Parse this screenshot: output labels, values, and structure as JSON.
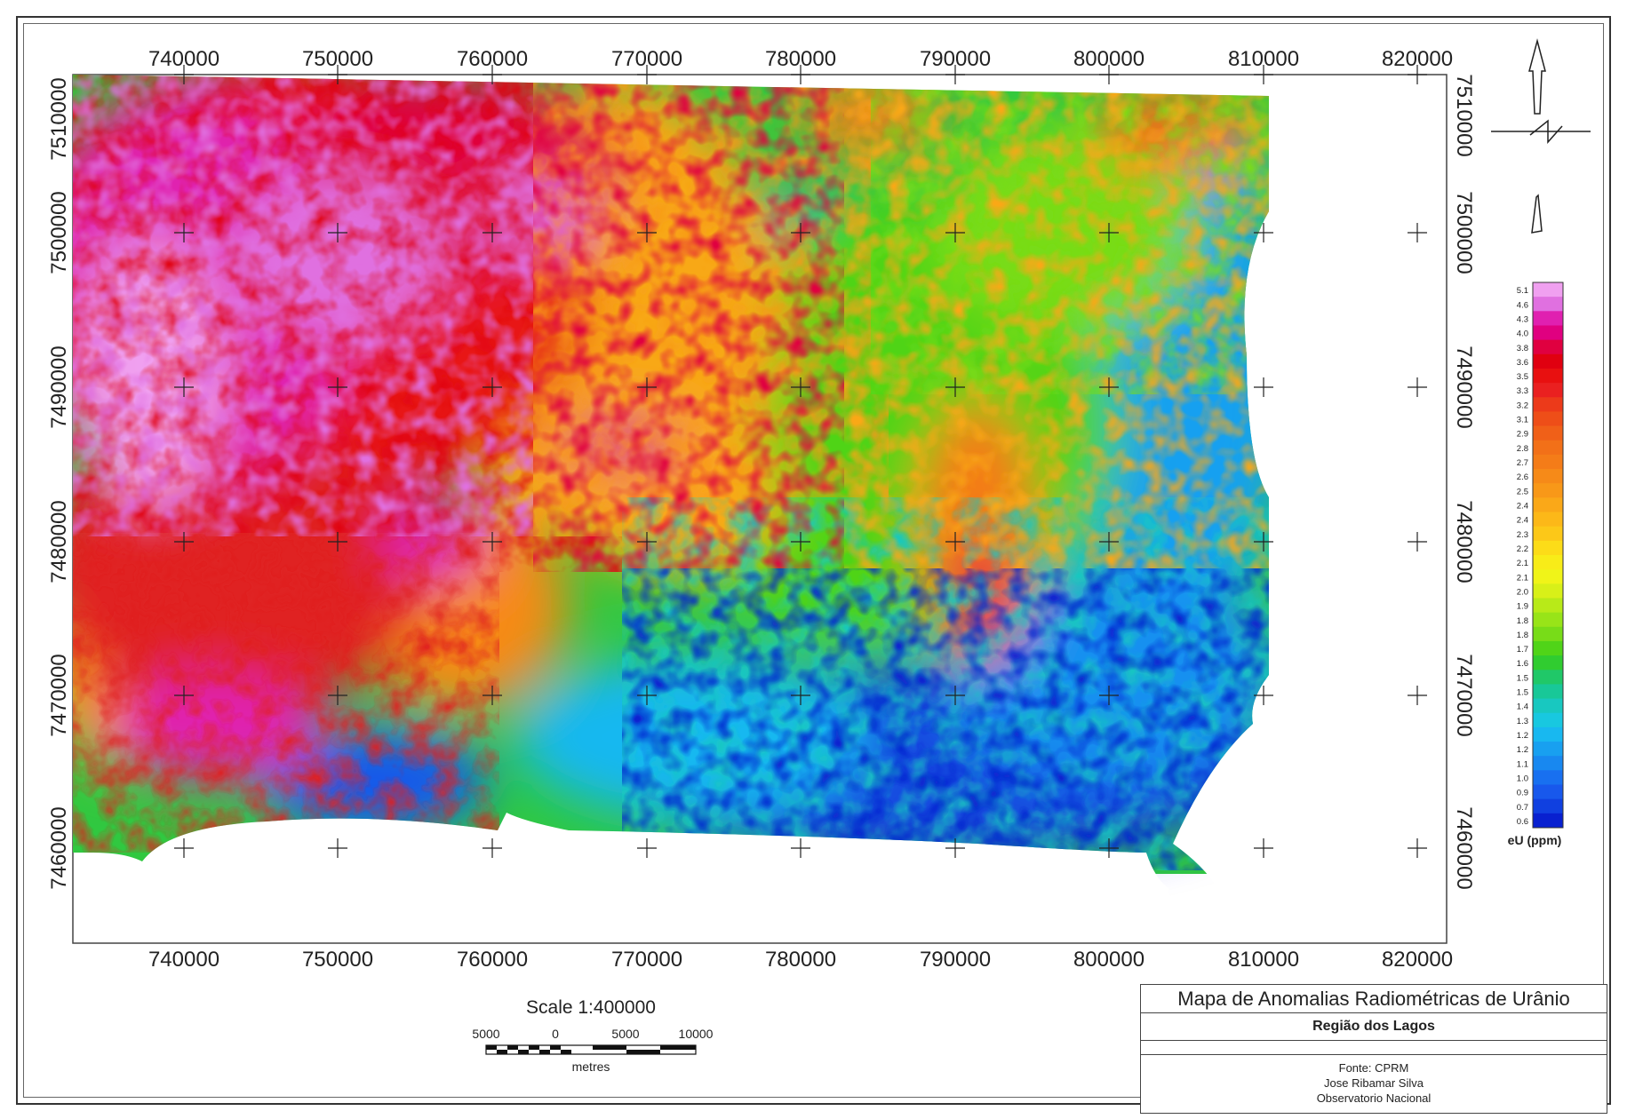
{
  "map": {
    "x_ticks": [
      "740000",
      "750000",
      "760000",
      "770000",
      "780000",
      "790000",
      "800000",
      "810000",
      "820000"
    ],
    "y_ticks": [
      "7510000",
      "7500000",
      "7490000",
      "7480000",
      "7470000",
      "7460000"
    ],
    "colormap_description": "rainbow: blue (low) to green, yellow, orange, red, magenta, pink (high)"
  },
  "legend": {
    "values": [
      "5.1",
      "4.6",
      "4.3",
      "4.0",
      "3.8",
      "3.6",
      "3.5",
      "3.3",
      "3.2",
      "3.1",
      "2.9",
      "2.8",
      "2.7",
      "2.6",
      "2.5",
      "2.4",
      "2.4",
      "2.3",
      "2.2",
      "2.1",
      "2.1",
      "2.0",
      "1.9",
      "1.8",
      "1.8",
      "1.7",
      "1.6",
      "1.5",
      "1.5",
      "1.4",
      "1.3",
      "1.2",
      "1.2",
      "1.1",
      "1.0",
      "0.9",
      "0.7",
      "0.6"
    ],
    "unit": "eU (ppm)",
    "colors": [
      "#f0a0f0",
      "#e070e0",
      "#e020b0",
      "#e00080",
      "#e00040",
      "#e00010",
      "#e81010",
      "#ea2020",
      "#ec3a1a",
      "#ee4e18",
      "#f06018",
      "#f27018",
      "#f47c18",
      "#f68a18",
      "#f89818",
      "#faa818",
      "#fcb818",
      "#fcc818",
      "#fcdc18",
      "#f8ec18",
      "#f0f418",
      "#d8f018",
      "#b8ea18",
      "#98e418",
      "#78dc18",
      "#50d418",
      "#30cc30",
      "#20c868",
      "#18c898",
      "#18c8c0",
      "#18c8e0",
      "#18b8f0",
      "#18a0f0",
      "#1888f0",
      "#1870f0",
      "#1858ec",
      "#1040e0",
      "#0820d0"
    ]
  },
  "scale": {
    "title": "Scale 1:400000",
    "labels": [
      "5000",
      "0",
      "5000",
      "10000"
    ],
    "unit": "metres"
  },
  "title_block": {
    "title": "Mapa de Anomalias Radiométricas de Urânio",
    "subtitle": "Região dos Lagos",
    "credits": [
      "Fonte: CPRM",
      "Jose Ribamar Silva",
      "Observatorio Nacional"
    ]
  }
}
